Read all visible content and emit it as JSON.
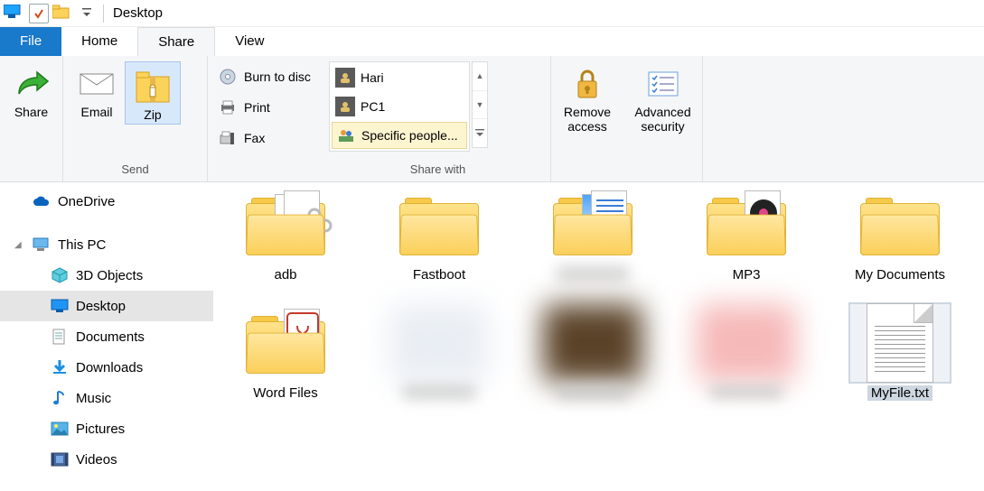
{
  "title_bar": {
    "location": "Desktop"
  },
  "tabs": {
    "file": "File",
    "home": "Home",
    "share": "Share",
    "view": "View"
  },
  "ribbon": {
    "share_grp": {
      "share": "Share",
      "email": "Email",
      "zip": "Zip"
    },
    "send_grp_label": "Send",
    "burn": "Burn to disc",
    "print": "Print",
    "fax": "Fax",
    "users": [
      "Hari",
      "PC1",
      "Specific people..."
    ],
    "sharewith_label": "Share with",
    "remove_access": "Remove access",
    "advanced_security": "Advanced security"
  },
  "nav": {
    "items": [
      {
        "label": "OneDrive",
        "icon": "cloud"
      },
      {
        "label": "This PC",
        "icon": "pc",
        "expanded": true
      },
      {
        "label": "3D Objects",
        "icon": "3d"
      },
      {
        "label": "Desktop",
        "icon": "desktop",
        "selected": true
      },
      {
        "label": "Documents",
        "icon": "doc"
      },
      {
        "label": "Downloads",
        "icon": "down"
      },
      {
        "label": "Music",
        "icon": "music"
      },
      {
        "label": "Pictures",
        "icon": "pic"
      },
      {
        "label": "Videos",
        "icon": "vid"
      }
    ]
  },
  "files": {
    "row1": [
      {
        "name": "adb",
        "type": "folder-gears"
      },
      {
        "name": "Fastboot",
        "type": "folder"
      },
      {
        "name": "",
        "type": "folder-docs-blur"
      },
      {
        "name": "MP3",
        "type": "folder-disc"
      },
      {
        "name": "My Documents",
        "type": "folder"
      }
    ],
    "row2": [
      {
        "name": "Word Files",
        "type": "folder-pdf"
      },
      {
        "name": "",
        "type": "blur"
      },
      {
        "name": "",
        "type": "blur-dark"
      },
      {
        "name": "",
        "type": "blur-red"
      },
      {
        "name": "MyFile.txt",
        "type": "txt",
        "selected": true
      }
    ]
  }
}
